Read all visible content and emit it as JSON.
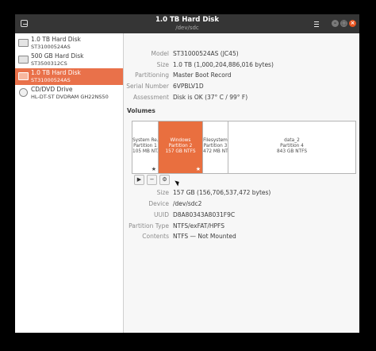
{
  "titlebar": {
    "title": "1.0 TB Hard Disk",
    "subtitle": "/dev/sdc"
  },
  "sidebar": {
    "items": [
      {
        "name": "1.0 TB Hard Disk",
        "sub": "ST31000524AS",
        "selected": false,
        "icon": "hard-disk-icon"
      },
      {
        "name": "500 GB Hard Disk",
        "sub": "ST3500312CS",
        "selected": false,
        "icon": "hard-disk-icon"
      },
      {
        "name": "1.0 TB Hard Disk",
        "sub": "ST31000524AS",
        "selected": true,
        "icon": "hard-disk-icon"
      },
      {
        "name": "CD/DVD Drive",
        "sub": "HL-DT-ST DVDRAM GH22NS50",
        "selected": false,
        "icon": "optical-disc-icon"
      }
    ]
  },
  "disk": {
    "model_label": "Model",
    "model": "ST31000524AS (JC45)",
    "size_label": "Size",
    "size": "1.0 TB (1,000,204,886,016 bytes)",
    "partitioning_label": "Partitioning",
    "partitioning": "Master Boot Record",
    "serial_label": "Serial Number",
    "serial": "6VPBLV1D",
    "assessment_label": "Assessment",
    "assessment": "Disk is OK (37° C / 99° F)"
  },
  "volumes": {
    "heading": "Volumes",
    "partitions": [
      {
        "line1": "System Re...",
        "line2": "Partition 1",
        "line3": "105 MB NT...",
        "star": "★",
        "selected": false
      },
      {
        "line1": "Windows",
        "line2": "Partition 2",
        "line3": "157 GB NTFS",
        "star": "★",
        "selected": true
      },
      {
        "line1": "Filesystem",
        "line2": "Partition 3",
        "line3": "472 MB NT...",
        "star": "",
        "selected": false
      },
      {
        "line1": "data_2",
        "line2": "Partition 4",
        "line3": "843 GB NTFS",
        "star": "",
        "selected": false
      }
    ],
    "tools": {
      "play": "▶",
      "minus": "−",
      "gear": "⚙"
    }
  },
  "partition": {
    "size_label": "Size",
    "size": "157 GB (156,706,537,472 bytes)",
    "device_label": "Device",
    "device": "/dev/sdc2",
    "uuid_label": "UUID",
    "uuid": "D8A80343A8031F9C",
    "type_label": "Partition Type",
    "type": "NTFS/exFAT/HPFS",
    "contents_label": "Contents",
    "contents": "NTFS — Not Mounted"
  },
  "colors": {
    "accent": "#e96f3f",
    "titlebar": "#353535",
    "close": "#e95420"
  }
}
